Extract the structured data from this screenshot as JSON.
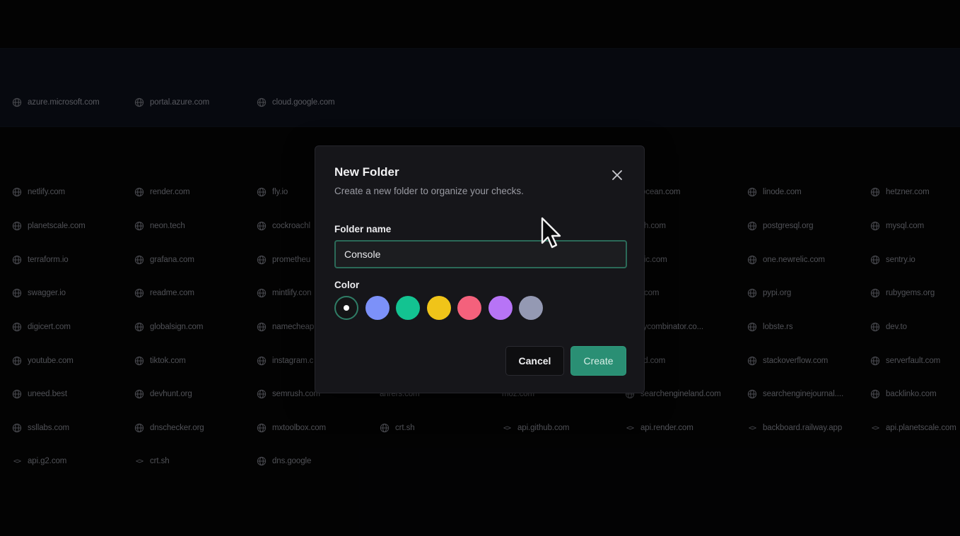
{
  "pinned_sites": [
    {
      "label": "azure.microsoft.com",
      "icon": "globe-icon"
    },
    {
      "label": "portal.azure.com",
      "icon": "globe-icon"
    },
    {
      "label": "cloud.google.com",
      "icon": "globe-icon"
    }
  ],
  "site_grid": [
    [
      {
        "label": "netlify.com",
        "icon": "globe-icon"
      },
      {
        "label": "render.com",
        "icon": "globe-icon"
      },
      {
        "label": "fly.io",
        "icon": "globe-icon"
      },
      {
        "label": "",
        "icon": ""
      },
      {
        "label": "",
        "icon": ""
      },
      {
        "label": "igitalocean.com",
        "icon": ""
      },
      {
        "label": "linode.com",
        "icon": "globe-icon"
      },
      {
        "label": "hetzner.com",
        "icon": "globe-icon"
      }
    ],
    [
      {
        "label": "planetscale.com",
        "icon": "globe-icon"
      },
      {
        "label": "neon.tech",
        "icon": "globe-icon"
      },
      {
        "label": "cockroachl",
        "icon": "globe-icon"
      },
      {
        "label": "",
        "icon": ""
      },
      {
        "label": "",
        "icon": ""
      },
      {
        "label": "pstash.com",
        "icon": ""
      },
      {
        "label": "postgresql.org",
        "icon": "globe-icon"
      },
      {
        "label": "mysql.com",
        "icon": "globe-icon"
      }
    ],
    [
      {
        "label": "terraform.io",
        "icon": "globe-icon"
      },
      {
        "label": "grafana.com",
        "icon": "globe-icon"
      },
      {
        "label": "prometheu",
        "icon": "globe-icon"
      },
      {
        "label": "",
        "icon": ""
      },
      {
        "label": "",
        "icon": ""
      },
      {
        "label": "ewrelic.com",
        "icon": ""
      },
      {
        "label": "one.newrelic.com",
        "icon": "globe-icon"
      },
      {
        "label": "sentry.io",
        "icon": "globe-icon"
      }
    ],
    [
      {
        "label": "swagger.io",
        "icon": "globe-icon"
      },
      {
        "label": "readme.com",
        "icon": "globe-icon"
      },
      {
        "label": "mintlify.con",
        "icon": "globe-icon"
      },
      {
        "label": "",
        "icon": ""
      },
      {
        "label": "",
        "icon": ""
      },
      {
        "label": "pmjs.com",
        "icon": ""
      },
      {
        "label": "pypi.org",
        "icon": "globe-icon"
      },
      {
        "label": "rubygems.org",
        "icon": "globe-icon"
      }
    ],
    [
      {
        "label": "digicert.com",
        "icon": "globe-icon"
      },
      {
        "label": "globalsign.com",
        "icon": "globe-icon"
      },
      {
        "label": "namecheap",
        "icon": "globe-icon"
      },
      {
        "label": "",
        "icon": ""
      },
      {
        "label": "",
        "icon": ""
      },
      {
        "label": "iews.ycombinator.co...",
        "icon": ""
      },
      {
        "label": "lobste.rs",
        "icon": "globe-icon"
      },
      {
        "label": "dev.to",
        "icon": "globe-icon"
      }
    ],
    [
      {
        "label": "youtube.com",
        "icon": "globe-icon"
      },
      {
        "label": "tiktok.com",
        "icon": "globe-icon"
      },
      {
        "label": "instagram.c",
        "icon": "globe-icon"
      },
      {
        "label": "",
        "icon": ""
      },
      {
        "label": "",
        "icon": ""
      },
      {
        "label": "liscord.com",
        "icon": ""
      },
      {
        "label": "stackoverflow.com",
        "icon": "globe-icon"
      },
      {
        "label": "serverfault.com",
        "icon": "globe-icon"
      }
    ],
    [
      {
        "label": "uneed.best",
        "icon": "globe-icon"
      },
      {
        "label": "devhunt.org",
        "icon": "globe-icon"
      },
      {
        "label": "semrush.com",
        "icon": "globe-icon"
      },
      {
        "label": "anrers.com",
        "icon": ""
      },
      {
        "label": "moz.com",
        "icon": ""
      },
      {
        "label": "searchengineland.com",
        "icon": "globe-icon"
      },
      {
        "label": "searchenginejournal....",
        "icon": "globe-icon"
      },
      {
        "label": "backlinko.com",
        "icon": "globe-icon"
      }
    ],
    [
      {
        "label": "ssllabs.com",
        "icon": "globe-icon"
      },
      {
        "label": "dnschecker.org",
        "icon": "globe-icon"
      },
      {
        "label": "mxtoolbox.com",
        "icon": "globe-icon"
      },
      {
        "label": "crt.sh",
        "icon": "globe-icon"
      },
      {
        "label": "api.github.com",
        "icon": "code-icon"
      },
      {
        "label": "api.render.com",
        "icon": "code-icon"
      },
      {
        "label": "backboard.railway.app",
        "icon": "code-icon"
      },
      {
        "label": "api.planetscale.com",
        "icon": "code-icon"
      }
    ],
    [
      {
        "label": "api.g2.com",
        "icon": "code-icon"
      },
      {
        "label": "crt.sh",
        "icon": "code-icon"
      },
      {
        "label": "dns.google",
        "icon": "globe-icon"
      },
      {
        "label": "",
        "icon": ""
      },
      {
        "label": "",
        "icon": ""
      },
      {
        "label": "",
        "icon": ""
      },
      {
        "label": "",
        "icon": ""
      },
      {
        "label": "",
        "icon": ""
      }
    ]
  ],
  "dialog": {
    "title": "New Folder",
    "subtitle": "Create a new folder to organize your checks.",
    "close_icon": "close-icon",
    "name_label": "Folder name",
    "name_value": "Console",
    "color_label": "Color",
    "colors": [
      "#141416",
      "#7c91f9",
      "#13c391",
      "#f0c419",
      "#f4617c",
      "#b774f6",
      "#9499b3"
    ],
    "selected_color_index": 0,
    "cancel_label": "Cancel",
    "create_label": "Create"
  }
}
